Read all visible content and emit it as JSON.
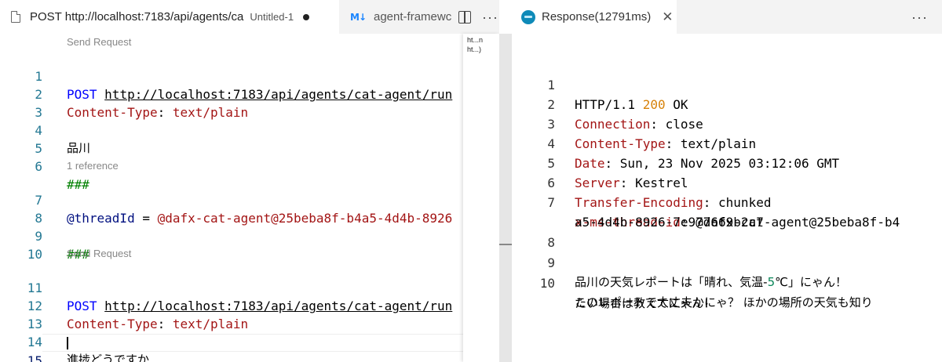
{
  "editor_tabs": [
    {
      "title": "POST http://localhost:7183/api/agents/ca",
      "description": "Untitled-1"
    },
    {
      "title": "agent-framewc"
    }
  ],
  "editor": {
    "code_lens": [
      "Send Request",
      "1 reference",
      "Send Request"
    ],
    "lines": {
      "l1": {
        "num": "1",
        "method": "POST",
        "url": "http://localhost:7183/api/agents/cat-agent/run"
      },
      "l2": {
        "num": "2",
        "header": "Content-Type",
        "value": "text/plain"
      },
      "l3": {
        "num": "3"
      },
      "l4": {
        "num": "4",
        "text": "品川"
      },
      "l5": {
        "num": "5"
      },
      "l6": {
        "num": "6",
        "text": "###"
      },
      "l7": {
        "num": "7",
        "var": "@threadId",
        "op": " = ",
        "value": "@dafx-cat-agent@25beba8f-b4a5-4d4b-8926"
      },
      "l8": {
        "num": "8"
      },
      "l9": {
        "num": "9",
        "text": "###"
      },
      "l10": {
        "num": "10"
      },
      "l11": {
        "num": "11",
        "method": "POST",
        "url": "http://localhost:7183/api/agents/cat-agent/run"
      },
      "l12": {
        "num": "12",
        "header": "Content-Type",
        "value": "text/plain"
      },
      "l13": {
        "num": "13"
      },
      "l14": {
        "num": "14",
        "text": "進捗どうですか"
      },
      "l15": {
        "num": "15"
      }
    },
    "minimap": [
      "ht...n",
      "ht...)"
    ]
  },
  "response_tab": {
    "title": "Response(12791ms)"
  },
  "response": {
    "lines": [
      {
        "num": "1",
        "pre": "HTTP/1.1 ",
        "status": "200",
        "post": " OK"
      },
      {
        "num": "2",
        "name": "Connection",
        "value": "close"
      },
      {
        "num": "3",
        "name": "Content-Type",
        "value": "text/plain"
      },
      {
        "num": "4",
        "name": "Date",
        "value": "Sun, 23 Nov 2025 03:12:06 GMT"
      },
      {
        "num": "5",
        "name": "Server",
        "value": "Kestrel"
      },
      {
        "num": "6",
        "name": "Transfer-Encoding",
        "value": "chunked"
      },
      {
        "num": "7",
        "name": "x-ms-thread-id",
        "value": "@dafx-cat-agent@25beba8f-b4",
        "cont": "a5-4d4b-8926-7e977669b2c7"
      },
      {
        "num": "8"
      },
      {
        "num": "9",
        "pre": "品川の天気レポートは「晴れ、気温-",
        "numv": "5",
        "post": "℃」にゃん！"
      },
      {
        "num": "10",
        "text": "このレポートで大丈夫かにゃ？ ほかの場所の天気も知り",
        "cont": "たい場合は教えてにゃん！"
      }
    ]
  },
  "colors": {
    "keyword": "#0000ff",
    "header": "#a31515",
    "comment": "#008000",
    "status": "#d7820a",
    "line_number": "#237893"
  }
}
